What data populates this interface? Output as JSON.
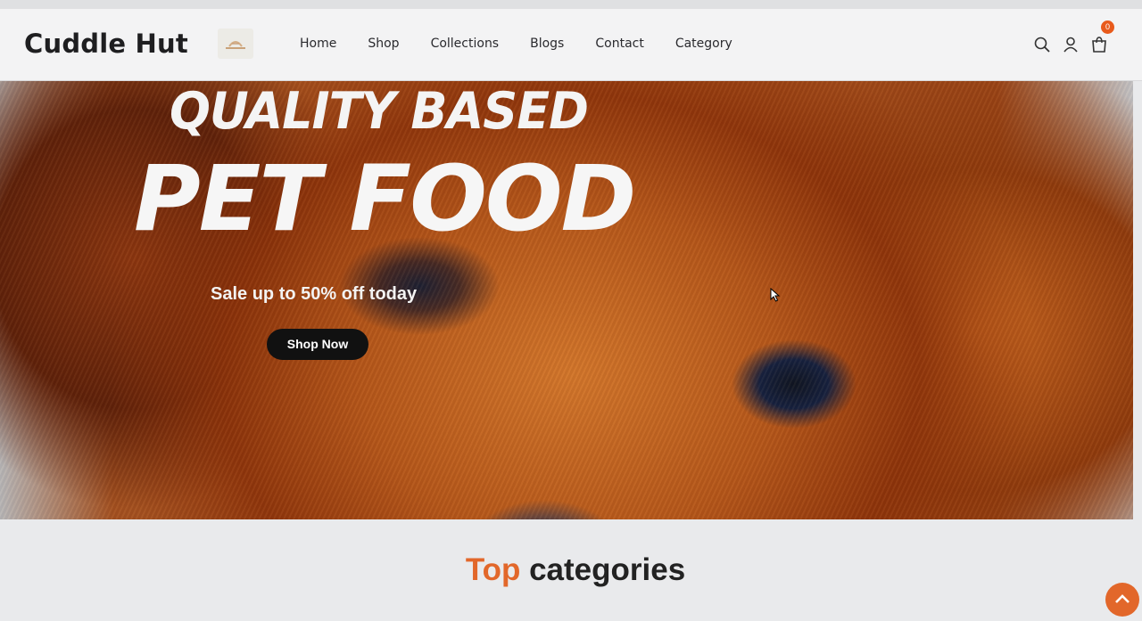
{
  "brand": {
    "name": "Cuddle Hut"
  },
  "nav": {
    "items": [
      {
        "label": "Home"
      },
      {
        "label": "Shop"
      },
      {
        "label": "Collections"
      },
      {
        "label": "Blogs"
      },
      {
        "label": "Contact"
      },
      {
        "label": "Category"
      }
    ]
  },
  "header_icons": [
    "search-icon",
    "user-icon",
    "cart-icon"
  ],
  "cart": {
    "count": "0"
  },
  "hero": {
    "title_line1": "QUALITY BASED",
    "title_line2": "PET FOOD",
    "subtitle": "Sale up to 50% off today",
    "cta_label": "Shop Now"
  },
  "section": {
    "title_accent": "Top",
    "title_rest": "categories"
  },
  "colors": {
    "accent": "#e2672a",
    "badge": "#e85a1b",
    "cta_bg": "#111111"
  }
}
